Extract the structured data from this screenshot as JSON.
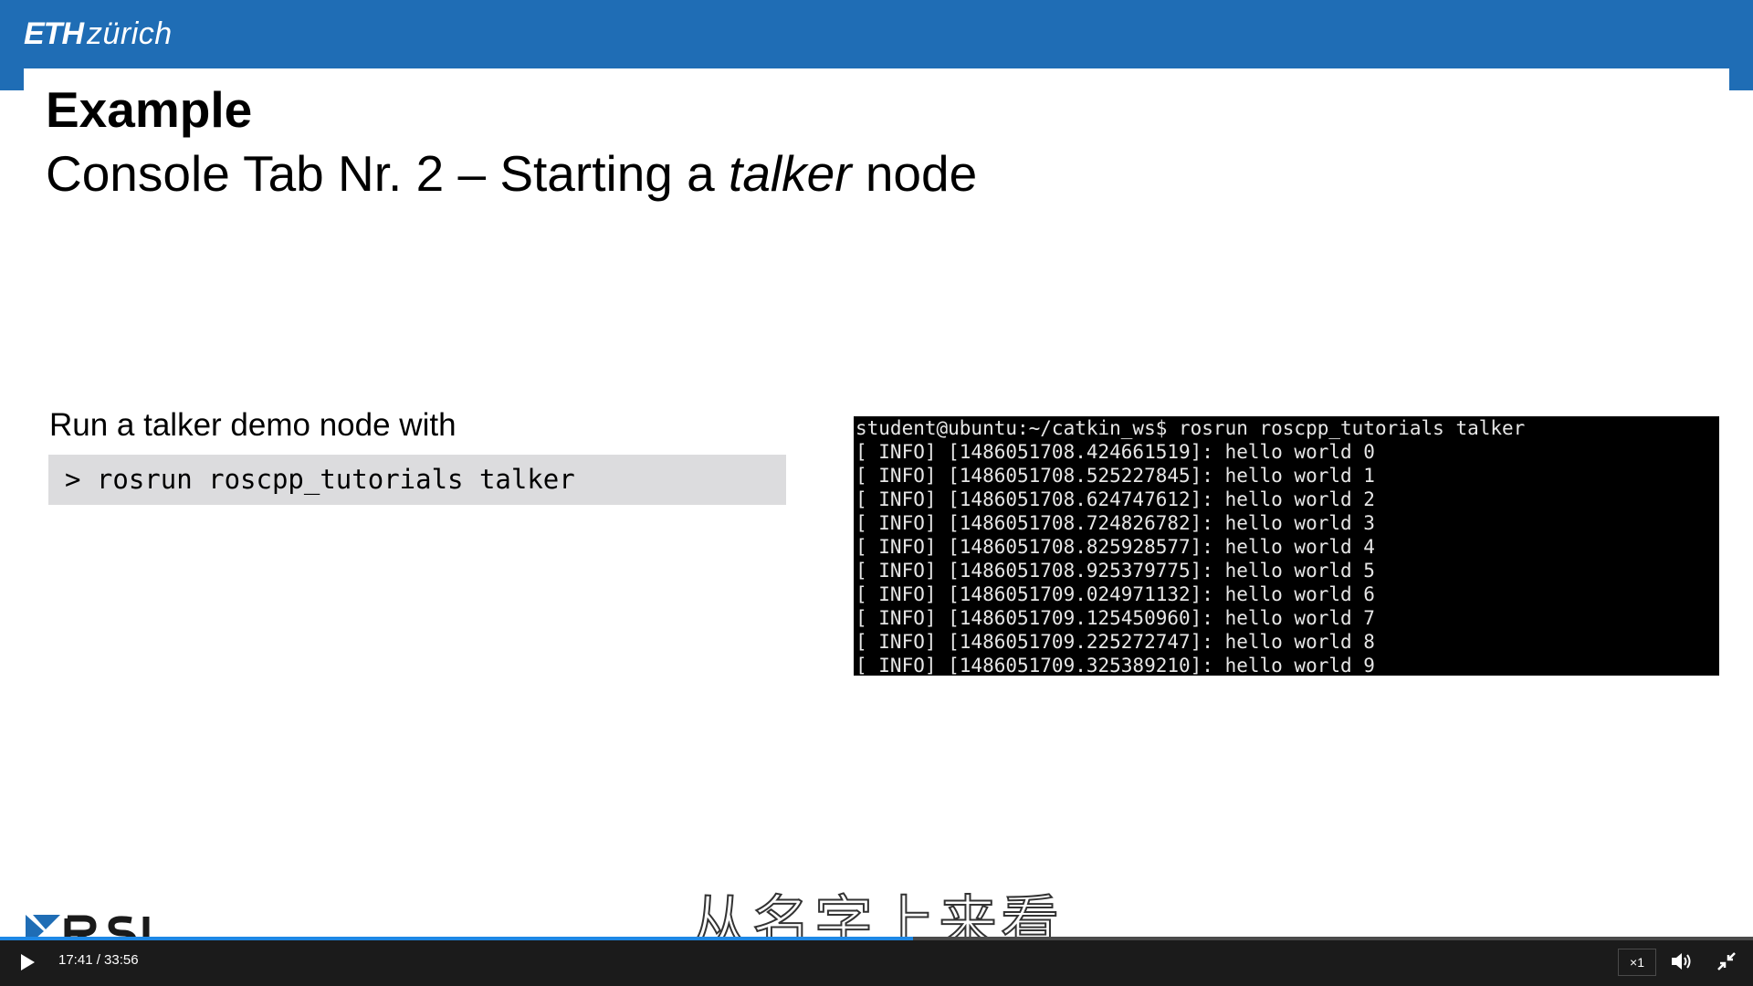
{
  "header": {
    "logo_eth": "ETH",
    "logo_zurich": "zürich"
  },
  "slide": {
    "title": "Example",
    "subtitle_pre": "Console Tab Nr. 2 – Starting a ",
    "subtitle_em": "talker",
    "subtitle_post": " node",
    "run_label": "Run a talker demo node with",
    "command": "> rosrun roscpp_tutorials talker"
  },
  "terminal": {
    "lines": [
      "student@ubuntu:~/catkin_ws$ rosrun roscpp_tutorials talker",
      "[ INFO] [1486051708.424661519]: hello world 0",
      "[ INFO] [1486051708.525227845]: hello world 1",
      "[ INFO] [1486051708.624747612]: hello world 2",
      "[ INFO] [1486051708.724826782]: hello world 3",
      "[ INFO] [1486051708.825928577]: hello world 4",
      "[ INFO] [1486051708.925379775]: hello world 5",
      "[ INFO] [1486051709.024971132]: hello world 6",
      "[ INFO] [1486051709.125450960]: hello world 7",
      "[ INFO] [1486051709.225272747]: hello world 8",
      "[ INFO] [1486051709.325389210]: hello world 9"
    ]
  },
  "video": {
    "subtitle": "从名字上来看",
    "current_time": "17:41",
    "duration": "33:56",
    "time_display": "17:41 / 33:56",
    "progress_fraction": 0.521,
    "speed": "×1",
    "play_icon": "play-icon",
    "volume_icon": "volume-icon",
    "fullscreen_icon": "exit-fullscreen-icon"
  },
  "colors": {
    "header_blue": "#1f6db5",
    "progress_blue": "#1e88e5",
    "terminal_bg": "#000000",
    "command_bg": "#dcdcde"
  }
}
